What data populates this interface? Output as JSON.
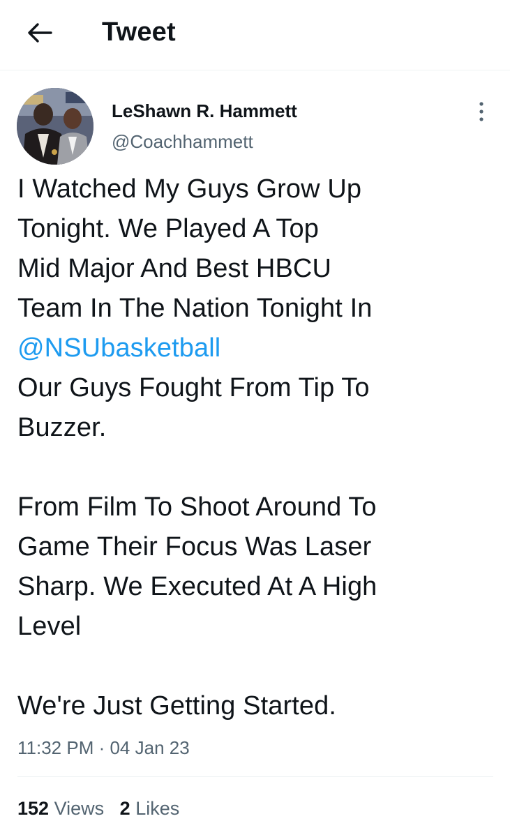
{
  "header": {
    "title": "Tweet",
    "back_icon": "arrow-left-icon"
  },
  "author": {
    "name": "LeShawn R. Hammett",
    "handle": "@Coachhammett",
    "avatar_icon": "profile-photo"
  },
  "more_icon": "more-vertical-icon",
  "tweet": {
    "lines": [
      "I Watched My Guys Grow Up",
      "Tonight. We Played A Top",
      "Mid Major And Best HBCU",
      "Team In The Nation Tonight In",
      "@NSUbasketball",
      "Our Guys Fought From Tip To",
      "Buzzer.",
      "",
      "From Film To Shoot Around To",
      "Game Their Focus Was Laser",
      "Sharp. We Executed At A High",
      "Level",
      "",
      "We're Just Getting Started."
    ],
    "mention": "@NSUbasketball",
    "mention_color": "#1d9bf0"
  },
  "timestamp": "11:32 PM · 04 Jan 23",
  "stats": {
    "views_count": "152",
    "views_label": "Views",
    "likes_count": "2",
    "likes_label": "Likes"
  },
  "colors": {
    "text": "#0f1419",
    "secondary": "#536471",
    "link": "#1d9bf0",
    "divider": "#eff3f4"
  }
}
